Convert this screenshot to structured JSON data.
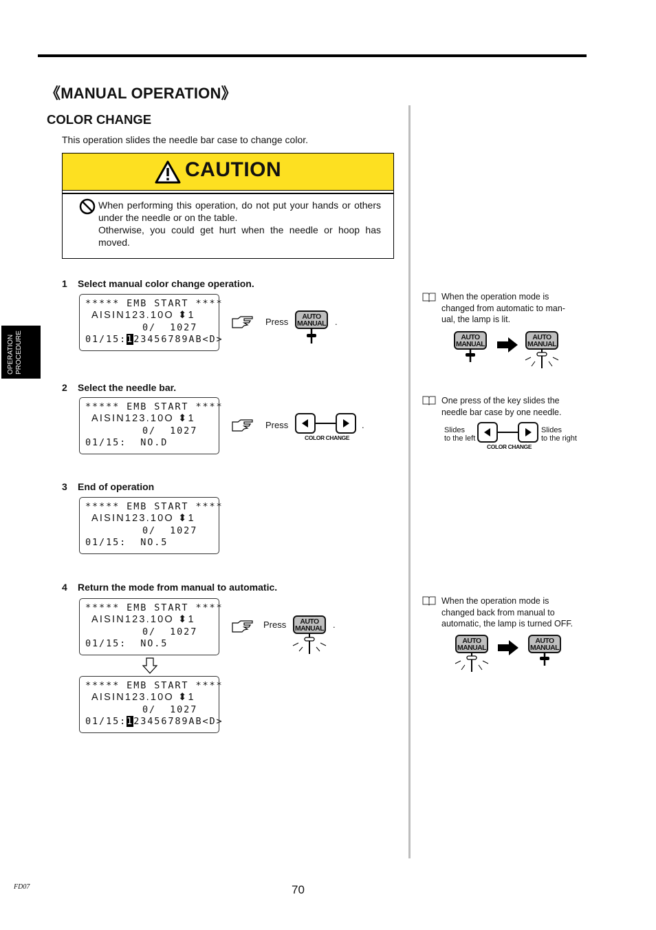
{
  "page": {
    "section_title": "《MANUAL OPERATION》",
    "subsection_title": "COLOR CHANGE",
    "intro": "This operation slides the needle bar case to change color.",
    "side_tab": [
      "OPERATION",
      "PROCEDURE"
    ],
    "footer_code": "FD07",
    "page_number": "70"
  },
  "caution": {
    "title": "CAUTION",
    "line1": "When performing this operation, do not put your hands or others under the needle or on the table.",
    "line2": "Otherwise, you could get hurt when the needle or hoop has moved.",
    "header_color": "#fde021"
  },
  "steps": [
    {
      "num": "1",
      "title": "Select manual color change operation.",
      "lcd": [
        "***** EMB START ****",
        "AISIN123.10O",
        "0/  1027",
        "01/15:",
        "1",
        "23456789AB<D>"
      ],
      "action": "Press",
      "key": "auto-manual"
    },
    {
      "num": "2",
      "title": "Select the needle bar.",
      "lcd": [
        "***** EMB START ****",
        "AISIN123.10O",
        "0/  1027",
        "01/15:  NO.D"
      ],
      "action": "Press",
      "key": "color-change"
    },
    {
      "num": "3",
      "title": "End of operation",
      "lcd": [
        "***** EMB START ****",
        "AISIN123.10O",
        "0/  1027",
        "01/15:  NO.5"
      ]
    },
    {
      "num": "4",
      "title": "Return the mode from manual to automatic.",
      "lcd_before": [
        "***** EMB START ****",
        "AISIN123.10O",
        "0/  1027",
        "01/15:  NO.5"
      ],
      "lcd_after": [
        "***** EMB START ****",
        "AISIN123.10O",
        "0/  1027",
        "01/15:",
        "1",
        "23456789AB<D>"
      ],
      "action": "Press",
      "key": "auto-manual"
    }
  ],
  "lcd_needle_indicator": "1",
  "keys": {
    "auto_manual_top": "AUTO",
    "auto_manual_bottom": "MANUAL",
    "color_change_label": "COLOR CHANGE"
  },
  "notes": [
    {
      "text": "When the operation mode is changed from automatic to man-ual, the lamp is lit.",
      "lines": [
        "When the operation mode is",
        "changed from automatic to man-",
        "ual, the lamp is lit."
      ]
    },
    {
      "lines": [
        "One press of the key slides the",
        "needle bar case by one needle."
      ],
      "left_label": [
        "Slides",
        "to the left"
      ],
      "right_label": [
        "Slides",
        "to the right"
      ]
    },
    {
      "lines": [
        "When the operation mode is",
        "changed back from manual to",
        "automatic, the lamp is turned OFF."
      ]
    }
  ]
}
